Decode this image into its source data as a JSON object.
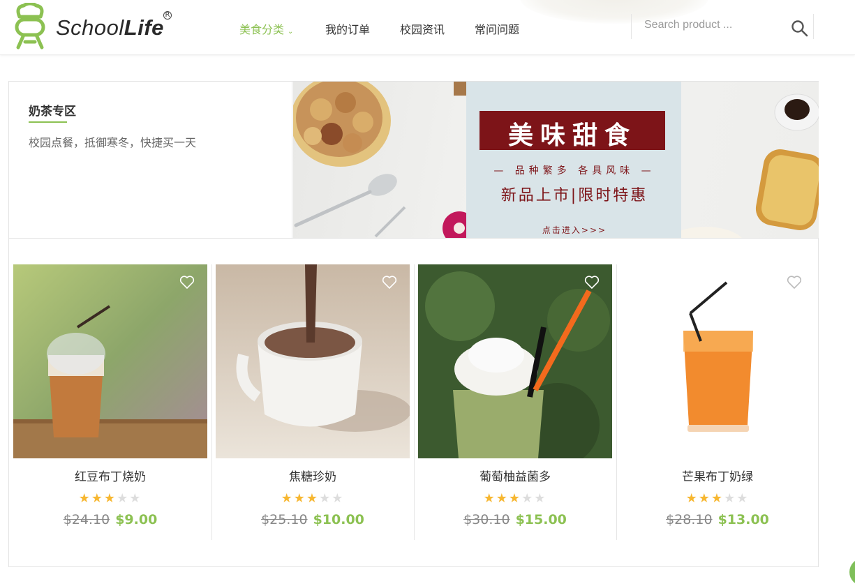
{
  "header": {
    "logo_text_regular": "School",
    "logo_text_bold": "Life",
    "logo_reg_mark": "R",
    "nav": [
      {
        "label": "美食分类",
        "active": true
      },
      {
        "label": "我的订单",
        "active": false
      },
      {
        "label": "校园资讯",
        "active": false
      },
      {
        "label": "常问问题",
        "active": false
      }
    ],
    "search": {
      "placeholder": "Search product ..."
    }
  },
  "promo": {
    "title": "奶茶专区",
    "subtitle": "校园点餐，抵御寒冬，快捷买一天",
    "banner": {
      "title": "美味甜食",
      "line1": "— 品种繁多  各具风味 —",
      "line2": "新品上市|限时特惠",
      "link": "点击进入>>>"
    }
  },
  "products": [
    {
      "name": "红豆布丁烧奶",
      "rating": 3,
      "old_price": "$24.10",
      "price": "$9.00"
    },
    {
      "name": "焦糖珍奶",
      "rating": 3,
      "old_price": "$25.10",
      "price": "$10.00"
    },
    {
      "name": "葡萄柚益菌多",
      "rating": 3,
      "old_price": "$30.10",
      "price": "$15.00"
    },
    {
      "name": "芒果布丁奶绿",
      "rating": 3,
      "old_price": "$28.10",
      "price": "$13.00"
    }
  ],
  "rating_max": 5,
  "colors": {
    "accent": "#8cc152",
    "star": "#f7b731",
    "banner_red": "#7d1418"
  }
}
